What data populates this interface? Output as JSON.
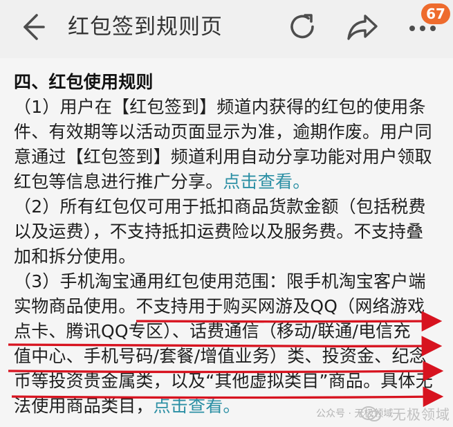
{
  "header": {
    "title": "红包签到规则页",
    "badge": "67",
    "icons": {
      "back": "back-arrow-icon",
      "refresh": "refresh-icon",
      "share": "share-icon",
      "more": "more-icon"
    }
  },
  "rules": {
    "heading": "四、红包使用规则",
    "lines": [
      "（1）用户在【红包签到】频道内获得的红包的使用条",
      "件、有效期等以活动页面显示为准，逾期作废。用户同",
      "意通过【红包签到】频道利用自动分享功能对用户领取",
      "红包等信息进行推广分享。",
      "（2）所有红包仅可用于抵扣商品货款金额（包括税费",
      "以及运费），不支持抵扣运费险以及服务费。不支持叠",
      "加和拆分使用。",
      "（3）手机淘宝通用红包使用范围：限手机淘宝客户端",
      "实物商品使用。不支持用于购买网游及QQ（网络游戏",
      "点卡、腾讯QQ专区）、话费通信（移动/联通/电信充",
      "值中心、手机号码/套餐/增值业务）类、投资金、纪念",
      "币等投资贵金属类，以及“其他虚拟类目”商品。具体无",
      "法使用商品类目，"
    ],
    "link_text_1": "点击查看。",
    "link_text_2": "点击查看。"
  },
  "footer": {
    "watermark": "公众号 · 无极领域",
    "logo": "无极领域"
  },
  "colors": {
    "accent": "#ee6b2d",
    "link": "#2b8fa4",
    "annotation": "#d7131f",
    "header_bg": "#f0f0f0",
    "content_bg": "#f5f5f5"
  }
}
